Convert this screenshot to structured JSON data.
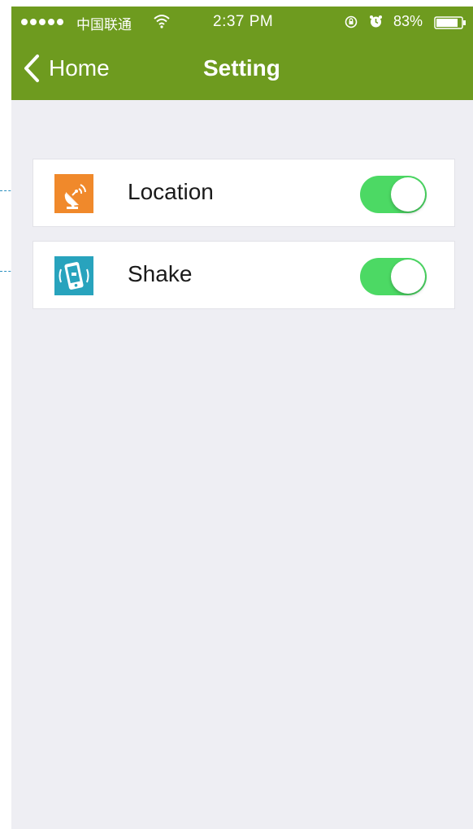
{
  "status_bar": {
    "carrier": "中国联通",
    "time": "2:37 PM",
    "battery_percent": "83%",
    "icons": [
      "signal-dots",
      "wifi-icon",
      "rotation-lock-icon",
      "alarm-icon",
      "battery-icon"
    ]
  },
  "nav": {
    "back_label": "Home",
    "title": "Setting"
  },
  "settings": [
    {
      "label": "Location",
      "icon": "satellite-dish-icon",
      "enabled": true,
      "icon_color": "#f0892b"
    },
    {
      "label": "Shake",
      "icon": "shake-phone-icon",
      "enabled": true,
      "icon_color": "#28a3bd"
    }
  ],
  "colors": {
    "nav_background": "#6e9b1f",
    "page_background": "#eeeef3",
    "toggle_on": "#4cd964",
    "callout_line": "#2a8fbf"
  }
}
